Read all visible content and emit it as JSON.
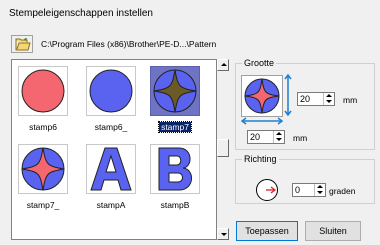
{
  "dialog": {
    "title": "Stempeleigenschappen instellen"
  },
  "path": {
    "text": "C:\\Program Files (x86)\\Brother\\PE-D...\\Pattern"
  },
  "stamps": [
    {
      "label": "stamp6",
      "selected": false
    },
    {
      "label": "stamp6_",
      "selected": false
    },
    {
      "label": "stamp7",
      "selected": true
    },
    {
      "label": "stamp7_",
      "selected": false
    },
    {
      "label": "stampA",
      "selected": false
    },
    {
      "label": "stampB",
      "selected": false
    }
  ],
  "size_group": {
    "legend": "Grootte",
    "height_value": "20",
    "width_value": "20",
    "unit": "mm"
  },
  "direction_group": {
    "legend": "Richting",
    "value": "0",
    "unit": "graden"
  },
  "buttons": {
    "apply": "Toepassen",
    "close": "Sluiten"
  },
  "colors": {
    "stamp_red": "#f46670",
    "stamp_blue": "#5a62f0",
    "selection": "#0a246a",
    "accent_arrow": "#1f7fd1"
  }
}
